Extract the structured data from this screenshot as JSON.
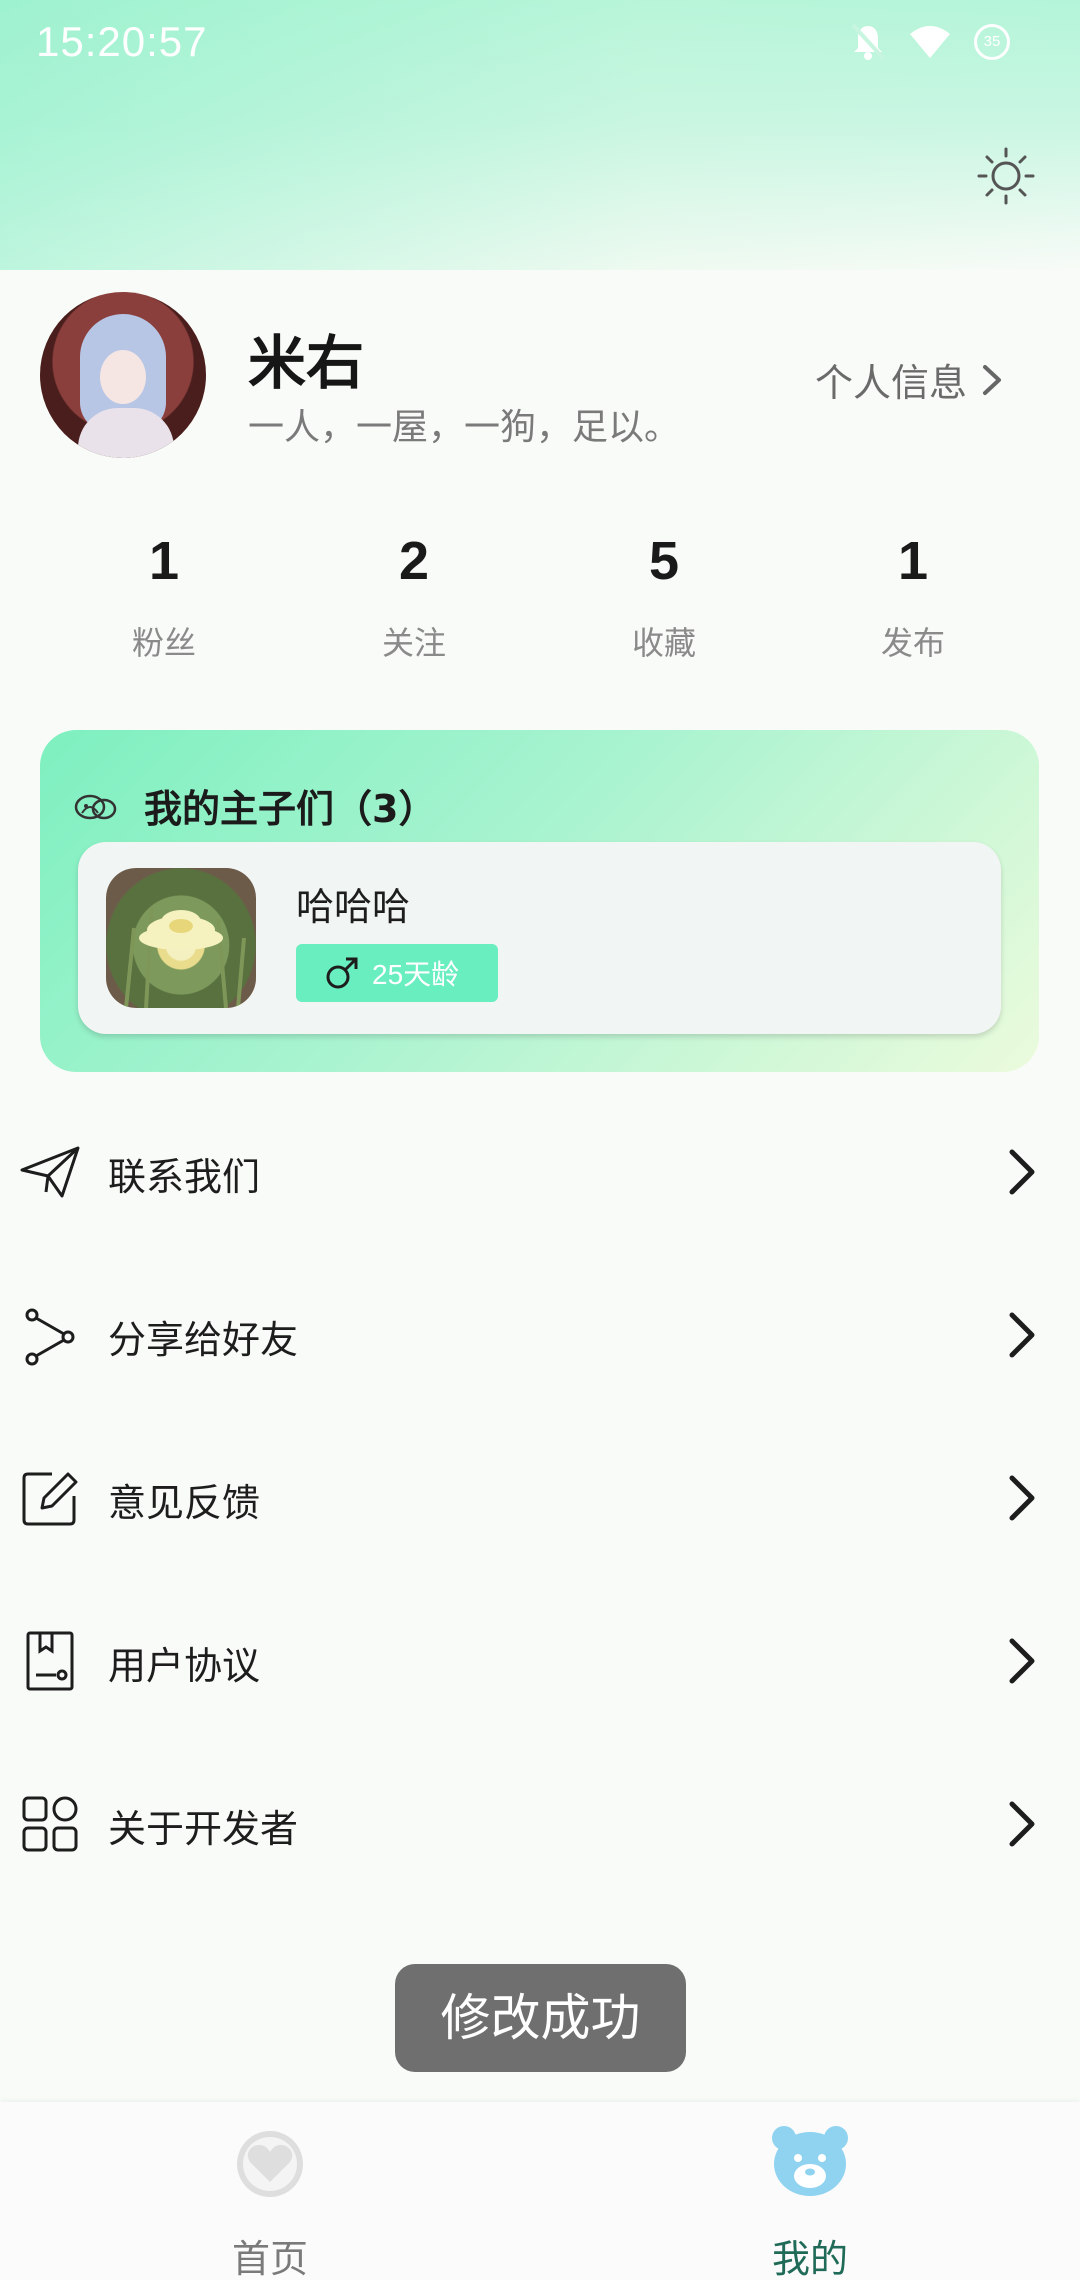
{
  "status_bar": {
    "time": "15:20:57",
    "battery": "35"
  },
  "profile": {
    "name": "米右",
    "bio": "一人，一屋，一狗，足以。",
    "info_link": "个人信息"
  },
  "stats": [
    {
      "value": "1",
      "label": "粉丝"
    },
    {
      "value": "2",
      "label": "关注"
    },
    {
      "value": "5",
      "label": "收藏"
    },
    {
      "value": "1",
      "label": "发布"
    }
  ],
  "pets": {
    "title": "我的主子们（3）",
    "items": [
      {
        "name": "哈哈哈",
        "age": "25天龄",
        "gender_icon": "male-icon"
      }
    ]
  },
  "menu": [
    {
      "label": "联系我们",
      "icon": "paper-plane-icon"
    },
    {
      "label": "分享给好友",
      "icon": "share-icon"
    },
    {
      "label": "意见反馈",
      "icon": "edit-icon"
    },
    {
      "label": "用户协议",
      "icon": "document-icon"
    },
    {
      "label": "关于开发者",
      "icon": "grid-icon"
    }
  ],
  "toast": "修改成功",
  "bottom_nav": [
    {
      "label": "首页",
      "icon": "heart-icon",
      "active": false
    },
    {
      "label": "我的",
      "icon": "bear-icon",
      "active": true
    }
  ],
  "colors": {
    "accent": "#69eec0",
    "active_nav": "#1f6b58",
    "inactive_nav": "#7a7a7a",
    "bear_icon": "#8fd3f0"
  }
}
